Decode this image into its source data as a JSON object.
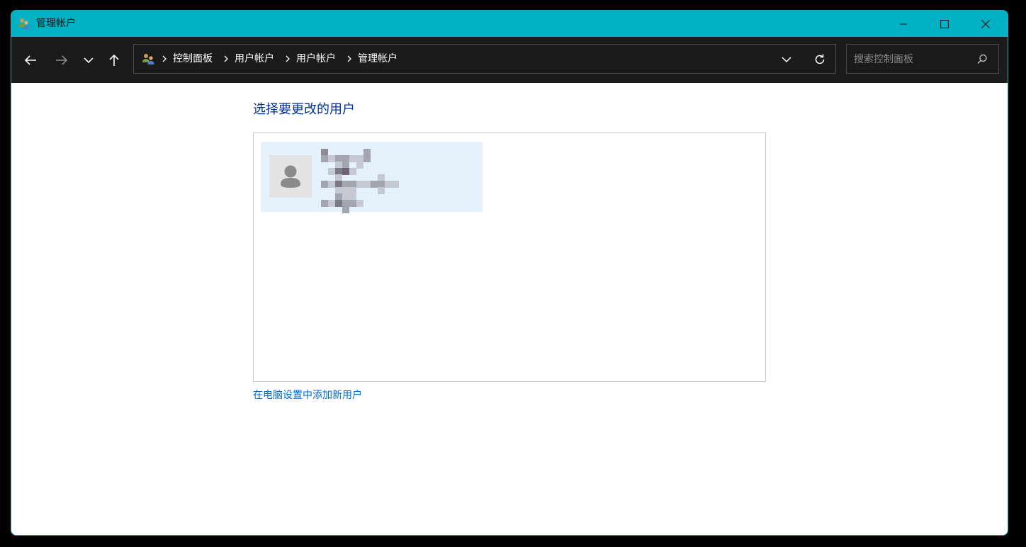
{
  "window": {
    "title": "管理帐户",
    "title_icon": "user-accounts-icon",
    "controls": [
      "minimize-icon",
      "maximize-icon",
      "close-icon"
    ]
  },
  "nav": {
    "buttons": [
      "back-icon",
      "forward-icon",
      "recent-locations-icon",
      "up-icon"
    ],
    "address": {
      "icon": "user-accounts-icon",
      "crumbs": [
        "控制面板",
        "用户帐户",
        "用户帐户",
        "管理帐户"
      ]
    },
    "search": {
      "placeholder": "搜索控制面板",
      "value": ""
    }
  },
  "main": {
    "heading": "选择要更改的用户",
    "users": [
      {
        "avatar_icon": "user-avatar-icon",
        "name_redacted": true,
        "selected": true
      }
    ],
    "add_user_link": "在电脑设置中添加新用户"
  },
  "colors": {
    "titlebar": "#00b2c3",
    "navbar": "#1b1b1b",
    "heading": "#003399",
    "link": "#0066cc",
    "selected_card": "#e5f1fb"
  }
}
